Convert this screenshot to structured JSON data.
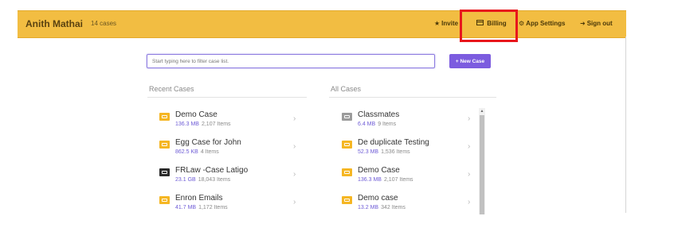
{
  "header": {
    "user_name": "Anith Mathai",
    "case_count": "14 cases",
    "nav": {
      "invite": "Invite",
      "billing": "Billing",
      "app_settings": "App Settings",
      "sign_out": "Sign out"
    },
    "icons": {
      "invite": "star-icon",
      "billing": "credit-card-icon",
      "app_settings": "gears-icon",
      "sign_out": "sign-out-icon"
    },
    "highlight_color": "#e8161c"
  },
  "filter": {
    "placeholder": "Start typing here to filter case list."
  },
  "new_case_button": "+ New Case",
  "recent_cases": {
    "title": "Recent Cases",
    "items": [
      {
        "name": "Demo Case",
        "size": "136.3 MB",
        "items": "2,107 Items",
        "folder": "yellow"
      },
      {
        "name": "Egg Case for John",
        "size": "862.5 KB",
        "items": "4 Items",
        "folder": "yellow"
      },
      {
        "name": "FRLaw -Case Latigo",
        "size": "23.1 GB",
        "items": "18,043 Items",
        "folder": "dark"
      },
      {
        "name": "Enron Emails",
        "size": "41.7 MB",
        "items": "1,172 Items",
        "folder": "yellow"
      }
    ]
  },
  "all_cases": {
    "title": "All Cases",
    "items": [
      {
        "name": "Classmates",
        "size": "6.4 MB",
        "items": "9 Items",
        "folder": "gray"
      },
      {
        "name": "De duplicate Testing",
        "size": "52.3 MB",
        "items": "1,536 Items",
        "folder": "yellow"
      },
      {
        "name": "Demo Case",
        "size": "136.3 MB",
        "items": "2,107 Items",
        "folder": "yellow"
      },
      {
        "name": "Demo case",
        "size": "13.2 MB",
        "items": "342 Items",
        "folder": "yellow"
      }
    ]
  },
  "colors": {
    "header_bg": "#f2bd42",
    "accent": "#7c5cdf",
    "folder_yellow": "#f5b623"
  }
}
